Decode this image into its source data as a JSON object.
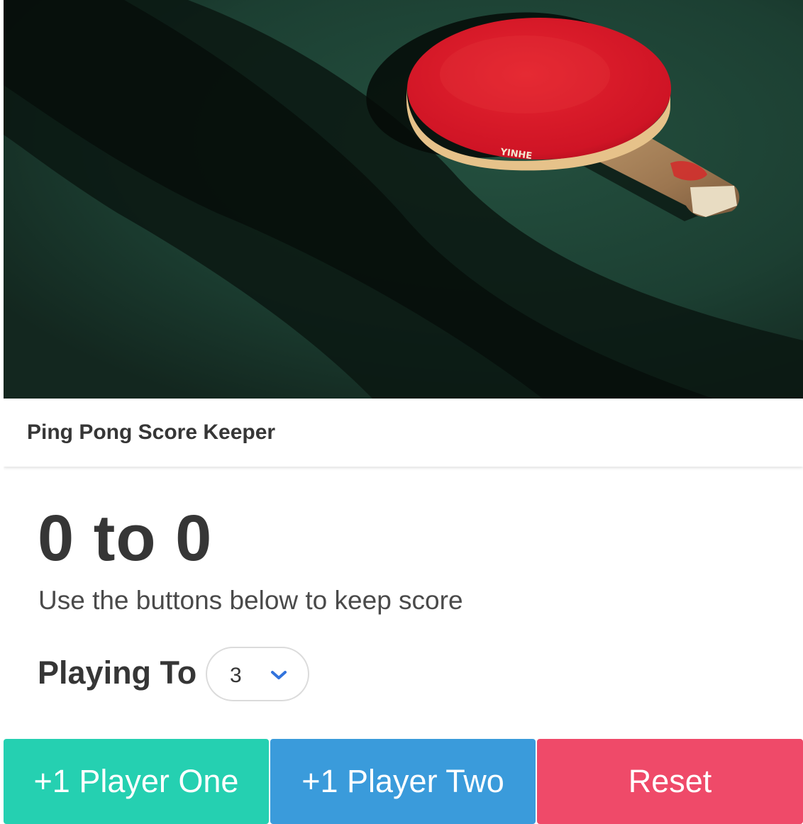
{
  "header": {
    "title": "Ping Pong Score Keeper"
  },
  "score": {
    "text": "0 to 0"
  },
  "instructions": "Use the buttons below to keep score",
  "playing_to": {
    "label": "Playing To",
    "selected": "3"
  },
  "buttons": {
    "player_one": "+1 Player One",
    "player_two": "+1 Player Two",
    "reset": "Reset"
  },
  "image": {
    "paddle_brand": "YINHE"
  },
  "colors": {
    "player_one": "#25d0b1",
    "player_two": "#3a9bdb",
    "reset": "#ef4a69",
    "table_green": "#1f4536",
    "paddle_red": "#d8192a",
    "select_chevron": "#3273dc"
  },
  "icons": {
    "select": "chevron-down-icon"
  }
}
